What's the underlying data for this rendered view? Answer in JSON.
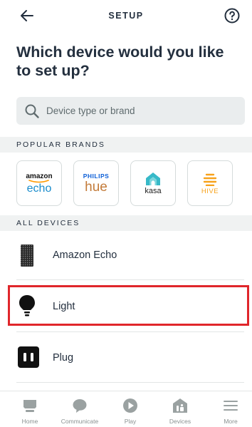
{
  "header": {
    "title": "SETUP",
    "back_icon": "back-arrow-icon",
    "help_icon": "help-circle-icon"
  },
  "heading": "Which device would you like to set up?",
  "search": {
    "placeholder": "Device type or brand",
    "icon": "search-icon"
  },
  "popular_brands": {
    "label": "POPULAR BRANDS",
    "items": [
      {
        "name": "amazon echo",
        "top": "amazon",
        "bottom": "echo"
      },
      {
        "name": "philips hue",
        "top": "PHILIPS",
        "bottom": "hue"
      },
      {
        "name": "kasa",
        "bottom": "kasa"
      },
      {
        "name": "HIVE",
        "bottom": "HIVE"
      }
    ]
  },
  "all_devices": {
    "label": "ALL DEVICES",
    "items": [
      {
        "label": "Amazon Echo",
        "icon": "echo-speaker-icon"
      },
      {
        "label": "Light",
        "icon": "light-bulb-icon"
      },
      {
        "label": "Plug",
        "icon": "smart-plug-icon"
      }
    ]
  },
  "highlight_color": "#e0262b",
  "tabs": [
    {
      "label": "Home",
      "icon": "home-icon"
    },
    {
      "label": "Communicate",
      "icon": "chat-bubble-icon"
    },
    {
      "label": "Play",
      "icon": "play-icon"
    },
    {
      "label": "Devices",
      "icon": "devices-house-icon"
    },
    {
      "label": "More",
      "icon": "menu-icon"
    }
  ]
}
